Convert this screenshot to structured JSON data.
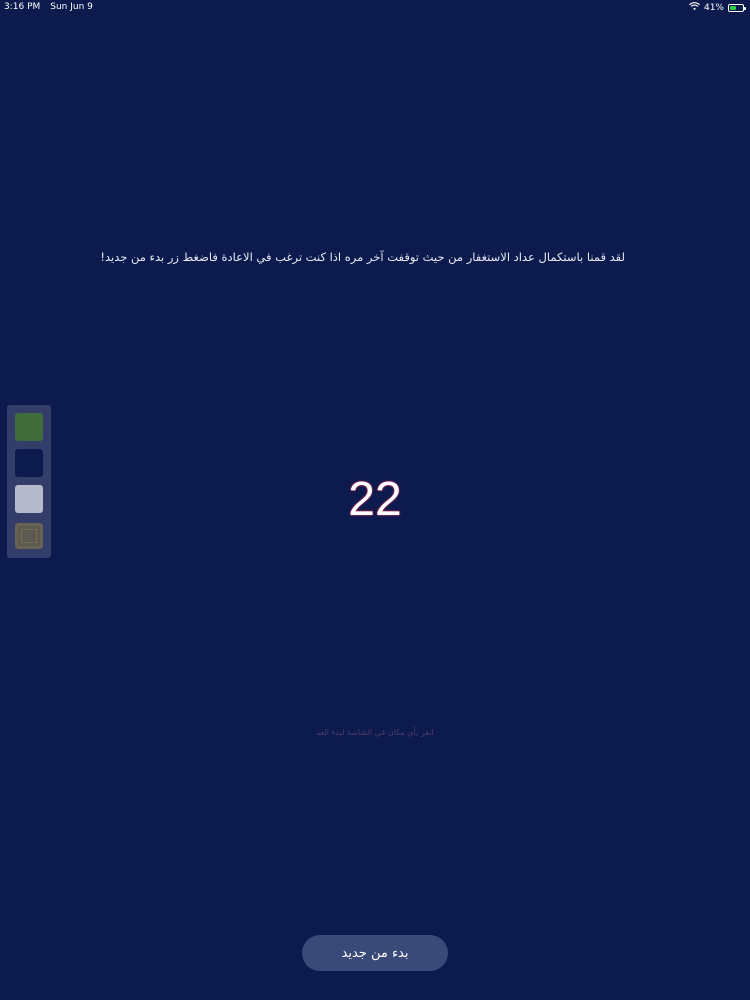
{
  "status_bar": {
    "time": "3:16 PM",
    "date": "Sun Jun 9",
    "battery_percent": "41%",
    "icons": [
      "wifi-icon",
      "battery-icon"
    ]
  },
  "message": "لقد قمنا باستكمال عداد الاستغفار من حيث توقفت آخر مره اذا كنت ترغب في الاعادة فاضغط زر بدء من جديد!",
  "color_panel": {
    "swatches": [
      {
        "name": "green",
        "color": "#4a7a37"
      },
      {
        "name": "navy",
        "color": "#0d1b4e"
      },
      {
        "name": "white",
        "color": "#d4d6e0"
      },
      {
        "name": "image",
        "icon": "image-background-icon"
      }
    ]
  },
  "counter": "22",
  "hint": "انقر بأي مكان في الشاشة لبدء العد",
  "restart_button": {
    "label": "بدء من جديد"
  },
  "colors": {
    "background": "#0c1a4d",
    "button": "#3a4a78",
    "counter_glow": "#e0355a"
  }
}
